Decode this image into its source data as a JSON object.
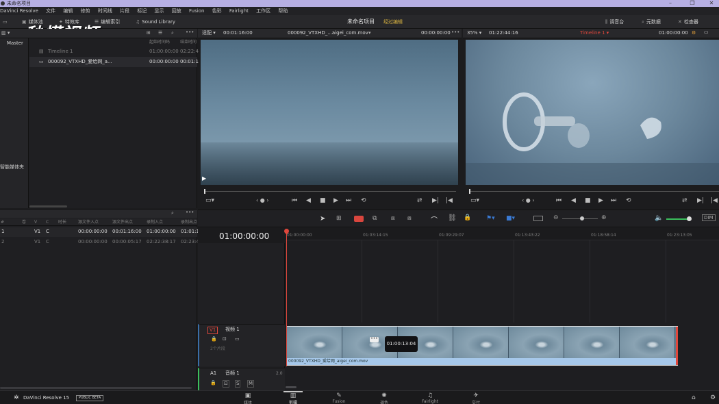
{
  "window": {
    "title": "未命名项目"
  },
  "menu": [
    "DaVinci Resolve",
    "文件",
    "编辑",
    "修剪",
    "时间线",
    "片段",
    "标记",
    "显示",
    "回放",
    "Fusion",
    "色彩",
    "Fairlight",
    "工作区",
    "帮助"
  ],
  "toolbar": {
    "media_pool": "媒体池",
    "effects": "特效库",
    "edit_index": "编辑索引",
    "sound_library": "Sound Library",
    "project_name": "未命名项目",
    "edited_status": "经过编辑",
    "mixer": "调音台",
    "metadata": "元数据",
    "inspector": "检查器"
  },
  "watermark": "秒懂视频",
  "media_pool": {
    "master": "Master",
    "smart_bins": "智能媒体夹",
    "columns": [
      "起始时间码",
      "结束时间"
    ],
    "items": [
      {
        "name": "Timeline 1",
        "start": "01:00:00:00",
        "end": "02:22:4"
      },
      {
        "name": "000092_VTXHD_爱给网_a...",
        "start": "00:00:00:00",
        "end": "00:01:1"
      }
    ]
  },
  "edit_index": {
    "columns": [
      "#",
      "卷",
      "V",
      "C",
      "时长",
      "源文件入点",
      "源文件出点",
      "录制入点",
      "录制出点"
    ],
    "rows": [
      {
        "num": "1",
        "reel": "",
        "v": "V1",
        "c": "C",
        "dur": "",
        "src_in": "00:00:00:00",
        "src_out": "00:01:16:00",
        "rec_in": "01:00:00:00",
        "rec_out": "01:01:1"
      },
      {
        "num": "2",
        "reel": "",
        "v": "V1",
        "c": "C",
        "dur": "",
        "src_in": "00:00:00:00",
        "src_out": "00:00:05:17",
        "rec_in": "02:22:38:17",
        "rec_out": "02:23:4"
      }
    ]
  },
  "source_viewer": {
    "fit": "适配",
    "duration": "00:01:16:00",
    "clip_name": "000092_VTXHD_...aigei_com.mov",
    "timecode": "00:00:00:00"
  },
  "timeline_viewer": {
    "zoom": "35%",
    "duration": "01:22:44:16",
    "timeline_name": "Timeline 1",
    "timecode": "01:00:00:00"
  },
  "timeline": {
    "current_timecode": "01:00:00:00",
    "ruler": [
      "01:00:00:00",
      "01:03:14:15",
      "01:09:29:07",
      "01:13:43:22",
      "01:18:58:14",
      "01:23:13:05"
    ],
    "video_track": {
      "id": "V1",
      "name": "视频 1",
      "clips_count": "2个片段"
    },
    "audio_track": {
      "id": "A1",
      "name": "音频 1",
      "level": "2.0"
    },
    "clip_name": "000092_VTXHD_爱给网_aigei_com.mov",
    "tooltip": "01:00:13:04"
  },
  "footer": {
    "app": "DaVinci Resolve 15",
    "badge": "PUBLIC BETA",
    "pages": [
      "媒体",
      "剪辑",
      "Fusion",
      "调色",
      "Fairlight",
      "交付"
    ]
  },
  "colors": {
    "accent_red": "#e0473c",
    "playhead": "#e0473c",
    "clip_blue": "#a6c8ea",
    "edited_yellow": "#d9b341"
  }
}
